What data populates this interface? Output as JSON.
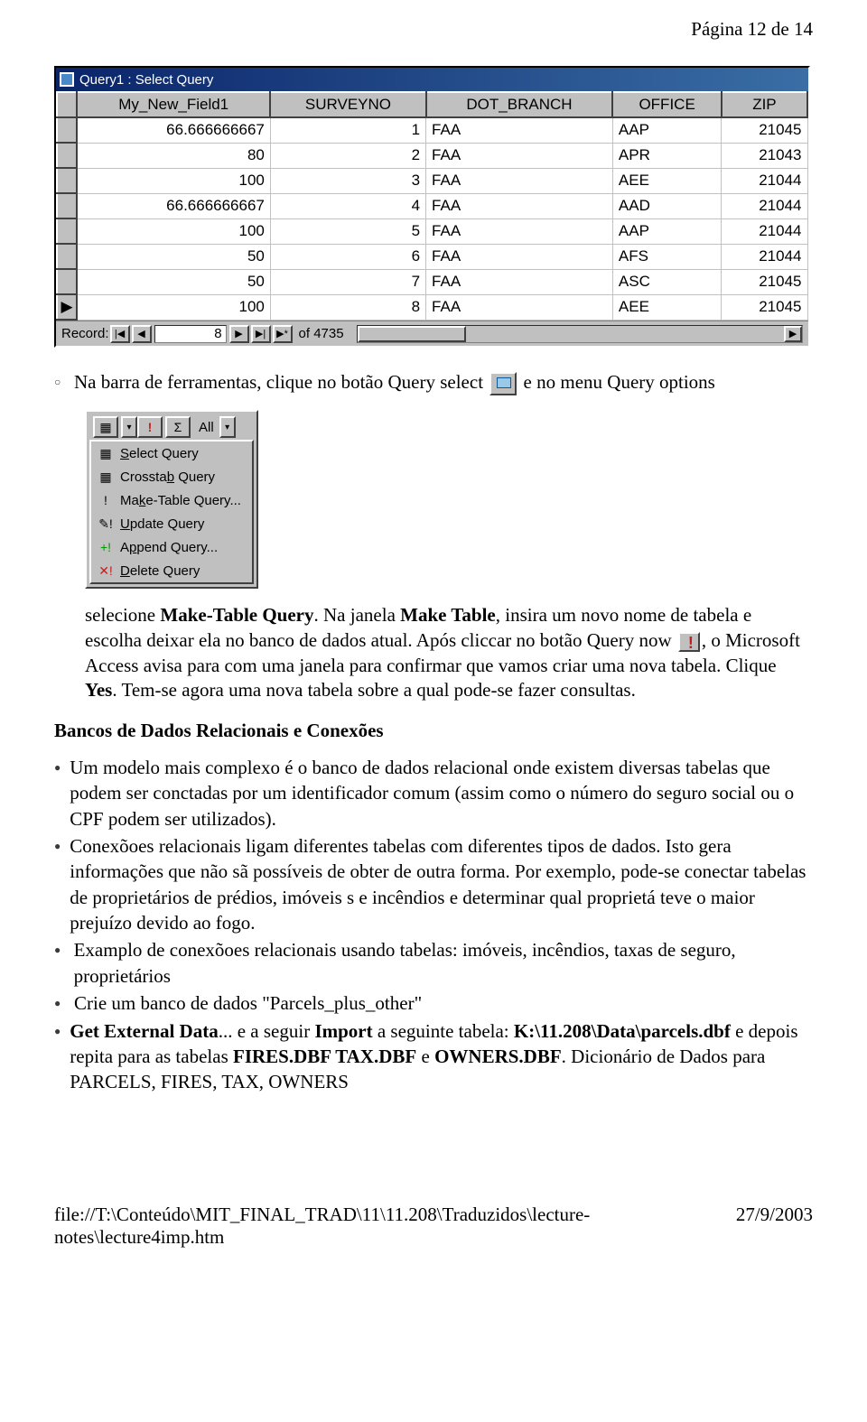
{
  "header": {
    "page_label": "Página 12 de 14"
  },
  "access_window": {
    "title": "Query1 : Select Query",
    "columns": [
      "My_New_Field1",
      "SURVEYNO",
      "DOT_BRANCH",
      "OFFICE",
      "ZIP"
    ],
    "rows": [
      {
        "sel": "",
        "c0": "66.666666667",
        "c1": "1",
        "c2": "FAA",
        "c3": "AAP",
        "c4": "21045"
      },
      {
        "sel": "",
        "c0": "80",
        "c1": "2",
        "c2": "FAA",
        "c3": "APR",
        "c4": "21043"
      },
      {
        "sel": "",
        "c0": "100",
        "c1": "3",
        "c2": "FAA",
        "c3": "AEE",
        "c4": "21044"
      },
      {
        "sel": "",
        "c0": "66.666666667",
        "c1": "4",
        "c2": "FAA",
        "c3": "AAD",
        "c4": "21044"
      },
      {
        "sel": "",
        "c0": "100",
        "c1": "5",
        "c2": "FAA",
        "c3": "AAP",
        "c4": "21044"
      },
      {
        "sel": "",
        "c0": "50",
        "c1": "6",
        "c2": "FAA",
        "c3": "AFS",
        "c4": "21044"
      },
      {
        "sel": "",
        "c0": "50",
        "c1": "7",
        "c2": "FAA",
        "c3": "ASC",
        "c4": "21045"
      },
      {
        "sel": "▶",
        "c0": "100",
        "c1": "8",
        "c2": "FAA",
        "c3": "AEE",
        "c4": "21045"
      }
    ],
    "nav": {
      "record_label": "Record:",
      "first": "|◀",
      "prev": "◀",
      "current": "8",
      "next": "▶",
      "last": "▶|",
      "new": "▶*",
      "of_text": "of 4735"
    }
  },
  "bullet1": {
    "pre": "Na barra de ferramentas, clique no botão Query select",
    "post": "e no menu Query options"
  },
  "toolbar": {
    "sigma": "Σ",
    "excl": "!",
    "all": "All",
    "arrow": "▾"
  },
  "menu": {
    "items": [
      {
        "icon": "▦",
        "pre": "",
        "u": "S",
        "rest": "elect Query"
      },
      {
        "icon": "▦",
        "pre": "Crossta",
        "u": "b",
        "rest": " Query"
      },
      {
        "icon": "!",
        "pre": "Ma",
        "u": "k",
        "rest": "e-Table Query..."
      },
      {
        "icon": "✎!",
        "pre": "",
        "u": "U",
        "rest": "pdate Query"
      },
      {
        "icon": "+!",
        "pre": "A",
        "u": "p",
        "rest": "pend Query..."
      },
      {
        "icon": "✕!",
        "pre": "",
        "u": "D",
        "rest": "elete Query"
      }
    ]
  },
  "para_select": {
    "pre": "selecione ",
    "bold1": "Make-Table Query",
    "mid1": ". Na janela ",
    "bold2": "Make Table",
    "mid2": ", insira um novo nome de tabela e escolha deixar ela no banco de dados atual. Após cliccar no botão Query now ",
    "post": ", o Microsoft Access avisa para com uma janela para confirmar que vamos criar uma nova tabela. Clique ",
    "bold3": "Yes",
    "tail": ". Tem-se agora uma nova tabela sobre a qual pode-se fazer consultas."
  },
  "section_heading": "Bancos de Dados Relacionais e Conexões",
  "list2": {
    "i0": "Um modelo mais complexo é o banco de dados relacional onde existem diversas tabelas que podem ser conctadas por um identificador comum (assim como o número do seguro social ou o CPF podem ser utilizados).",
    "i1": "Conexõoes relacionais ligam diferentes tabelas com diferentes tipos de dados. Isto gera informações que não sã possíveis de obter de outra forma. Por exemplo, pode-se conectar tabelas de proprietários de prédios, imóveis s e incêndios e determinar qual proprietá teve o maior prejuízo devido ao fogo.",
    "i2": "Examplo de conexõoes relacionais usando tabelas: imóveis, incêndios, taxas de seguro, proprietários",
    "i3": "Crie um banco de dados \"Parcels_plus_other\"",
    "i4_bold1": "Get External Data",
    "i4_mid1": "... e a seguir ",
    "i4_bold2": "Import",
    "i4_mid2": " a seguinte tabela: ",
    "i4_bold3": "K:\\11.208\\Data\\parcels.dbf",
    "i4_mid3": " e depois repita para as tabelas ",
    "i4_bold4": "FIRES.DBF  TAX.DBF",
    "i4_mid4": " e ",
    "i4_bold5": "OWNERS.DBF",
    "i4_tail": ". Dicionário de Dados para PARCELS, FIRES, TAX, OWNERS"
  },
  "footer": {
    "path": "file://T:\\Conteúdo\\MIT_FINAL_TRAD\\11\\11.208\\Traduzidos\\lecture-notes\\lecture4imp.htm",
    "date": "27/9/2003"
  }
}
